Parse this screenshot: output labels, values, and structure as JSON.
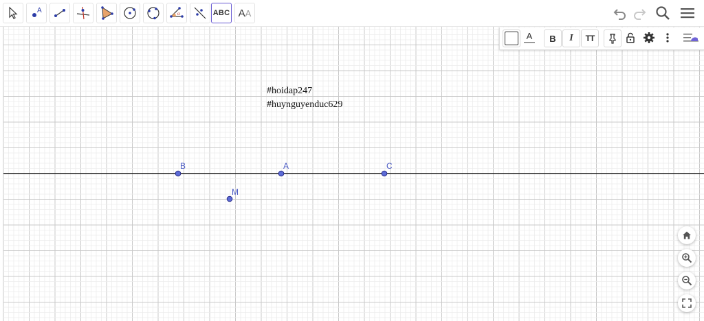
{
  "toolbar": {
    "tools": [
      {
        "name": "move-tool-icon"
      },
      {
        "name": "point-tool-icon",
        "label": "A"
      },
      {
        "name": "segment-tool-icon"
      },
      {
        "name": "perpendicular-line-tool-icon"
      },
      {
        "name": "polygon-tool-icon"
      },
      {
        "name": "circle-center-point-tool-icon"
      },
      {
        "name": "circle-three-points-tool-icon"
      },
      {
        "name": "angle-tool-icon",
        "label": "α"
      },
      {
        "name": "reflect-tool-icon"
      },
      {
        "name": "text-tool-icon",
        "label": "ABC"
      },
      {
        "name": "slider-tool-icon",
        "label_primary": "A",
        "label_secondary": "A"
      }
    ],
    "selected_tool": "text-tool-icon"
  },
  "style_bar": {
    "text_color_label": "A",
    "bold_label": "B",
    "italic_label": "I",
    "size_label": "TT"
  },
  "canvas": {
    "text_lines": [
      "#hoidap247",
      "#huynguyenduc629"
    ],
    "points": [
      {
        "label": "B"
      },
      {
        "label": "A"
      },
      {
        "label": "C"
      },
      {
        "label": "M"
      }
    ],
    "colors": {
      "point_fill": "#5c6bd6",
      "point_stroke": "#2c2f8a",
      "label": "#4b5bc4",
      "line": "#1a1a1a",
      "grid_major": "#c8c8c8",
      "grid_minor": "#ececec",
      "selected_tool_border": "#6557d2"
    }
  }
}
